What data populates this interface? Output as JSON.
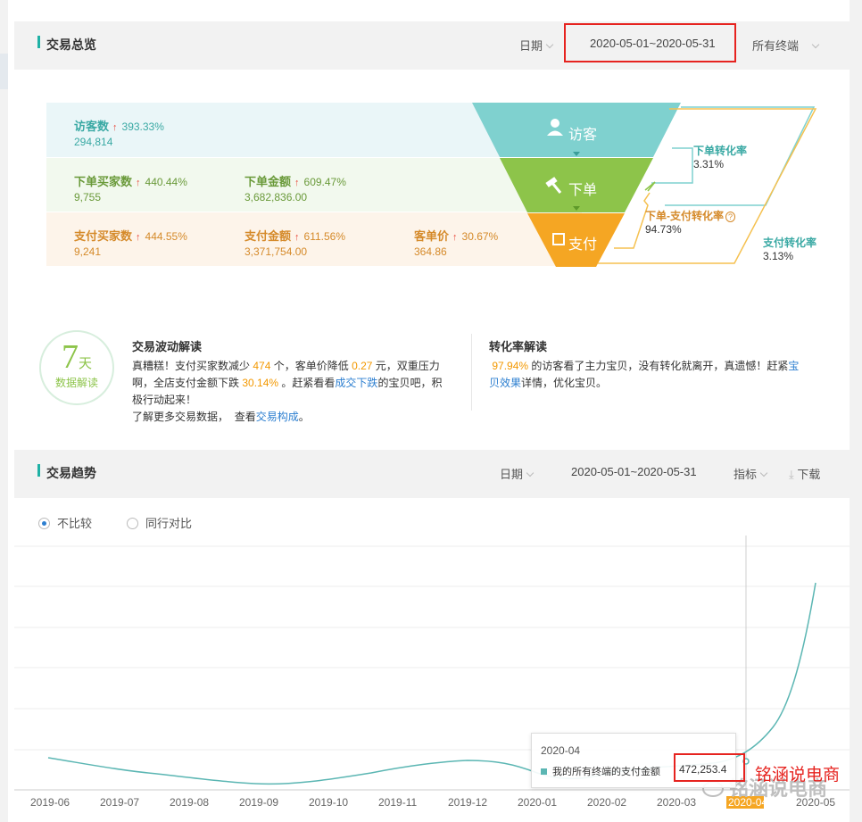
{
  "overview": {
    "title": "交易总览",
    "date_label": "日期",
    "date_range": "2020-05-01~2020-05-31",
    "terminal": "所有终端"
  },
  "funnel": {
    "visitor_stage": "访客",
    "order_stage": "下单",
    "pay_stage": "支付",
    "row1": [
      {
        "name": "访客数",
        "pct": "393.33%",
        "value": "294,814"
      }
    ],
    "row2": [
      {
        "name": "下单买家数",
        "pct": "440.44%",
        "value": "9,755"
      },
      {
        "name": "下单金额",
        "pct": "609.47%",
        "value": "3,682,836.00"
      }
    ],
    "row3": [
      {
        "name": "支付买家数",
        "pct": "444.55%",
        "value": "9,241"
      },
      {
        "name": "支付金额",
        "pct": "611.56%",
        "value": "3,371,754.00"
      },
      {
        "name": "客单价",
        "pct": "30.67%",
        "value": "364.86"
      }
    ],
    "conv_order_label": "下单转化率",
    "conv_order_value": "3.31%",
    "conv_order_pay_label": "下单-支付转化率",
    "conv_order_pay_value": "94.73%",
    "conv_pay_label": "支付转化率",
    "conv_pay_value": "3.13%"
  },
  "interp": {
    "badge_num": "7",
    "badge_unit": "天",
    "badge_label": "数据解读",
    "trade_title": "交易波动解读",
    "trade_t1": "真糟糕！支付买家数减少",
    "trade_n1": "474",
    "trade_t2": "个，客单价降低",
    "trade_n2": "0.27",
    "trade_t3": "元，双重压力",
    "trade_t4": "啊，全店支付金额下跌",
    "trade_n3": "30.14%",
    "trade_t5": "。赶紧看看",
    "trade_link1": "成交下跌",
    "trade_t6": "的宝贝吧，积",
    "trade_t7": "极行动起来！",
    "trade_t8": "了解更多交易数据，",
    "trade_t9": "查看",
    "trade_link2": "交易构成",
    "trade_t10": "。",
    "conv_title": "转化率解读",
    "conv_n1": "97.94%",
    "conv_t1": "的访客看了主力宝贝，没有转化就离开，真遗憾！赶紧",
    "conv_link1a": "宝",
    "conv_link1b": "贝效果",
    "conv_t2": "详情，优化宝贝。"
  },
  "trend": {
    "title": "交易趋势",
    "date_label": "日期",
    "date_range": "2020-05-01~2020-05-31",
    "indicator": "指标",
    "download": "下载",
    "radio_nocompare": "不比较",
    "radio_peer": "同行对比",
    "x_ticks": [
      "2019-06",
      "2019-07",
      "2019-08",
      "2019-09",
      "2019-10",
      "2019-11",
      "2019-12",
      "2020-01",
      "2020-02",
      "2020-03",
      "2020-04",
      "2020-05"
    ],
    "tooltip_month": "2020-04",
    "tooltip_series": "我的所有终端的支付金额",
    "tooltip_value": "472,253.4",
    "watermark": "铭涵说电商",
    "watermark_bg": "铭涵说电商"
  },
  "colors": {
    "teal": "#1fb1a5",
    "funnel_top": "#7fd1cf",
    "funnel_mid": "#8dc44a",
    "funnel_bot": "#f5a623",
    "highlight_red": "#e6231f"
  }
}
